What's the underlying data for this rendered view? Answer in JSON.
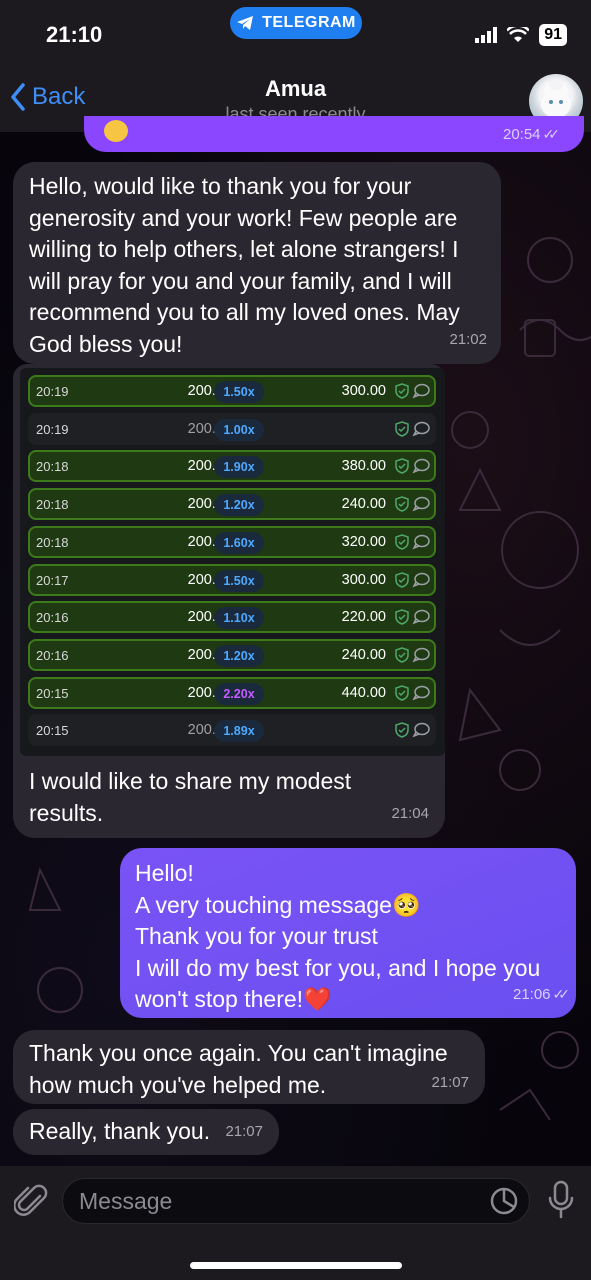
{
  "status_bar": {
    "time": "21:10",
    "app_pill": "TELEGRAM",
    "battery": "91"
  },
  "header": {
    "back_label": "Back",
    "contact_name": "Amua",
    "contact_status": "last seen recently"
  },
  "messages": [
    {
      "dir": "out",
      "time": "20:54"
    },
    {
      "dir": "in",
      "text": "Hello, would like to thank you for your generosity and your work! Few people are willing to help others, let alone strangers! I will pray for you and your family, and I will recommend you to all my loved ones. May God bless you!",
      "time": "21:02"
    },
    {
      "dir": "in",
      "caption": "I would like to share my modest results.",
      "time": "21:04"
    },
    {
      "dir": "out",
      "lines": [
        "Hello!",
        "A very touching message🥺",
        "Thank you for your trust",
        "I will do my best for you, and I hope you won't stop there!❤️"
      ],
      "time": "21:06"
    },
    {
      "dir": "in",
      "text": "Thank you once again. You can't imagine how much you've helped me.",
      "time": "21:07"
    },
    {
      "dir": "in",
      "text": "Really, thank you.",
      "time": "21:07"
    }
  ],
  "bets_table": {
    "rows": [
      {
        "time": "20:19",
        "bet": "200.00",
        "mult": "1.50x",
        "win": "300.00",
        "state": "win"
      },
      {
        "time": "20:19",
        "bet": "200.00",
        "mult": "1.00x",
        "win": "",
        "state": "lose"
      },
      {
        "time": "20:18",
        "bet": "200.00",
        "mult": "1.90x",
        "win": "380.00",
        "state": "win"
      },
      {
        "time": "20:18",
        "bet": "200.00",
        "mult": "1.20x",
        "win": "240.00",
        "state": "win"
      },
      {
        "time": "20:18",
        "bet": "200.00",
        "mult": "1.60x",
        "win": "320.00",
        "state": "win"
      },
      {
        "time": "20:17",
        "bet": "200.00",
        "mult": "1.50x",
        "win": "300.00",
        "state": "win"
      },
      {
        "time": "20:16",
        "bet": "200.00",
        "mult": "1.10x",
        "win": "220.00",
        "state": "win"
      },
      {
        "time": "20:16",
        "bet": "200.00",
        "mult": "1.20x",
        "win": "240.00",
        "state": "win"
      },
      {
        "time": "20:15",
        "bet": "200.00",
        "mult": "2.20x",
        "win": "440.00",
        "state": "win",
        "mult_color": "purple"
      },
      {
        "time": "20:15",
        "bet": "200.00",
        "mult": "1.89x",
        "win": "",
        "state": "lose"
      }
    ]
  },
  "input": {
    "placeholder": "Message"
  },
  "colors": {
    "accent": "#3e8ef7",
    "outgoing": "#6f4cf5",
    "incoming": "#2b2730",
    "win_row": "#1f3a12",
    "win_border": "#3d7a1a"
  }
}
